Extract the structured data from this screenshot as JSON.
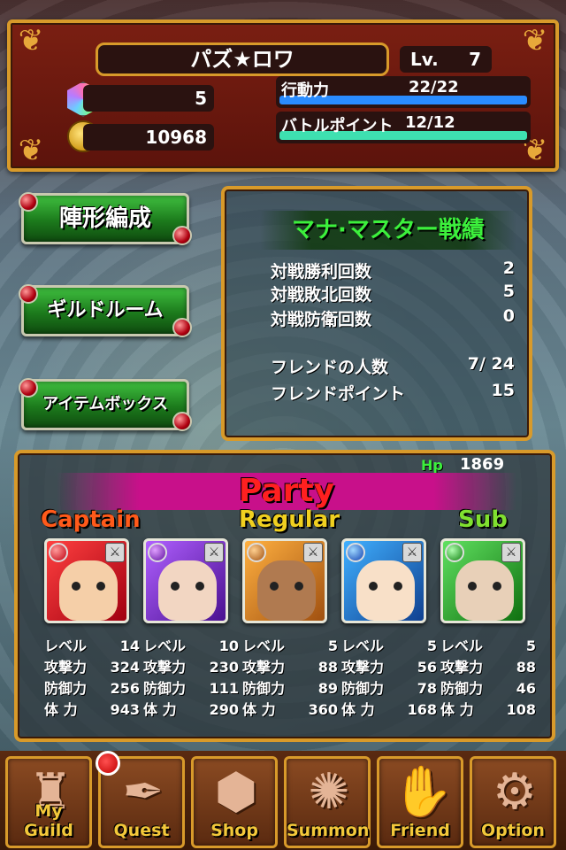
{
  "header": {
    "player_name": "パズ★ロワ",
    "level_label": "Lv.",
    "level": "7",
    "gems": "5",
    "coins": "10968",
    "action_label": "行動力",
    "action_value": "22/22",
    "action_fraction": 1.0,
    "battle_label": "バトルポイント",
    "battle_value": "12/12",
    "battle_fraction": 1.0
  },
  "menu": {
    "formation": "陣形編成",
    "guild_room": "ギルドルーム",
    "item_box": "アイテムボックス"
  },
  "record": {
    "title": "マナ·マスター戦績",
    "rows": [
      {
        "label": "対戦勝利回数",
        "value": "2"
      },
      {
        "label": "対戦敗北回数",
        "value": "5"
      },
      {
        "label": "対戦防衛回数",
        "value": "0"
      },
      {
        "label": "フレンドの人数",
        "value": "7/ 24"
      },
      {
        "label": "フレンドポイント",
        "value": "15"
      }
    ]
  },
  "party": {
    "hp_label": "Hp",
    "hp_value": "1869",
    "title": "Party",
    "captain_label": "Captain",
    "regular_label": "Regular",
    "sub_label": "Sub",
    "stat_labels": {
      "level": "レベル",
      "attack": "攻撃力",
      "defense": "防御力",
      "hp": "体 力"
    },
    "members": [
      {
        "element": "fire",
        "level": "14",
        "attack": "324",
        "defense": "256",
        "hp": "943"
      },
      {
        "element": "dark",
        "level": "10",
        "attack": "230",
        "defense": "111",
        "hp": "290"
      },
      {
        "element": "earth",
        "level": "5",
        "attack": "88",
        "defense": "89",
        "hp": "360"
      },
      {
        "element": "water",
        "level": "5",
        "attack": "56",
        "defense": "78",
        "hp": "168"
      },
      {
        "element": "wind",
        "level": "5",
        "attack": "88",
        "defense": "46",
        "hp": "108"
      }
    ]
  },
  "nav": [
    {
      "label": "My Guild",
      "icon": "castle-icon"
    },
    {
      "label": "Quest",
      "icon": "quill-icon"
    },
    {
      "label": "Shop",
      "icon": "bag-icon"
    },
    {
      "label": "Summon",
      "icon": "magic-circle-icon"
    },
    {
      "label": "Friend",
      "icon": "handshake-icon"
    },
    {
      "label": "Option",
      "icon": "gear-icon"
    }
  ],
  "colors": {
    "accent_gold": "#d89a2a",
    "action_bar": "#2a8cff",
    "battle_bar": "#3ee0b0",
    "green_text": "#3cf03c",
    "party_red": "#ff2020"
  }
}
